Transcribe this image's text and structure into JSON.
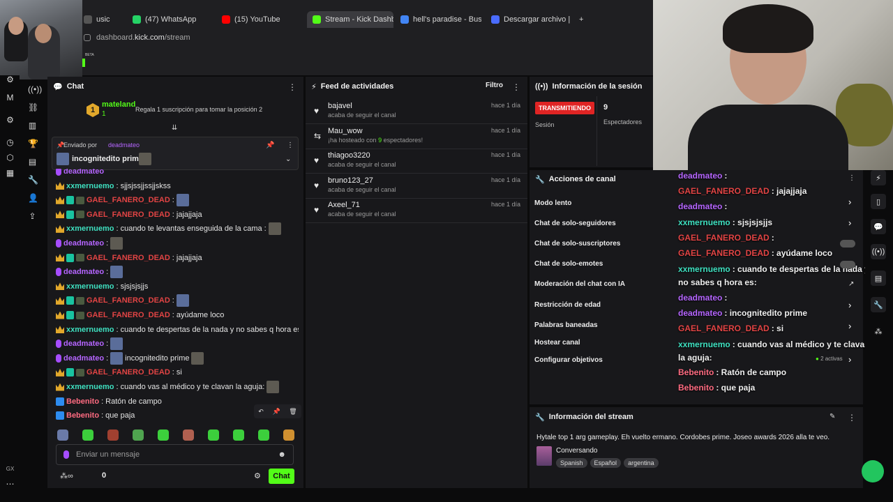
{
  "browser": {
    "tabs": [
      {
        "label": "usic",
        "fav": "#555555"
      },
      {
        "label": "(47) WhatsApp",
        "fav": "#25d366"
      },
      {
        "label": "(15) YouTube",
        "fav": "#ff0000"
      },
      {
        "label": "Stream - Kick Dashboard",
        "fav": "#53fc18",
        "active": true
      },
      {
        "label": "hell's paradise - Buscar c",
        "fav": "#4285f4"
      },
      {
        "label": "Descargar archivo | iLove",
        "fav": "#4a6cff"
      }
    ],
    "new_tab": "+",
    "url_host": "dashboard.",
    "url_domain": "kick.com",
    "url_path": "/stream",
    "beta": "BETA"
  },
  "leftnav": {
    "gx_label": "GX"
  },
  "chat": {
    "title": "Chat",
    "leader_name": "mateland",
    "leader_rank": "1",
    "leader_subs": "1",
    "gift_prompt": "Regala 1 suscripción para tomar la posición 2",
    "pinned_prefix": "Enviado por",
    "pinned_user": "deadmateo",
    "pinned_text": "incognitedito prime",
    "messages": [
      {
        "user": "deadmateo",
        "cls": "u-purple",
        "badges": [
          "mic"
        ],
        "text": ""
      },
      {
        "user": "xxmernuemo",
        "cls": "u-teal",
        "badges": [
          "crown"
        ],
        "text": ": sjjsjssjjssjjskss"
      },
      {
        "user": "GAEL_FANERO_DEAD",
        "cls": "u-red",
        "badges": [
          "crown",
          "sub",
          "lp"
        ],
        "text": ":",
        "emote": true
      },
      {
        "user": "GAEL_FANERO_DEAD",
        "cls": "u-red",
        "badges": [
          "crown",
          "sub",
          "lp"
        ],
        "text": ": jajajjaja"
      },
      {
        "user": "xxmernuemo",
        "cls": "u-teal",
        "badges": [
          "crown"
        ],
        "text": ": cuando te levantas enseguida de la cama :",
        "emote2": true
      },
      {
        "user": "deadmateo",
        "cls": "u-purple",
        "badges": [
          "mic"
        ],
        "text": ":",
        "emote2": true
      },
      {
        "user": "GAEL_FANERO_DEAD",
        "cls": "u-red",
        "badges": [
          "crown",
          "sub",
          "lp"
        ],
        "text": ": jajajjaja"
      },
      {
        "user": "deadmateo",
        "cls": "u-purple",
        "badges": [
          "mic"
        ],
        "text": ":",
        "emote": true
      },
      {
        "user": "xxmernuemo",
        "cls": "u-teal",
        "badges": [
          "crown"
        ],
        "text": ": sjsjsjsjjs"
      },
      {
        "user": "GAEL_FANERO_DEAD",
        "cls": "u-red",
        "badges": [
          "crown",
          "sub",
          "lp"
        ],
        "text": ":",
        "emote": true
      },
      {
        "user": "GAEL_FANERO_DEAD",
        "cls": "u-red",
        "badges": [
          "crown",
          "sub",
          "lp"
        ],
        "text": ": ayúdame loco"
      },
      {
        "user": "xxmernuemo",
        "cls": "u-teal",
        "badges": [
          "crown"
        ],
        "text": ": cuando te despertas de la nada y no sabes q hora es:",
        "emote2": true
      },
      {
        "user": "deadmateo",
        "cls": "u-purple",
        "badges": [
          "mic"
        ],
        "text": ":",
        "emote": true
      },
      {
        "user": "deadmateo",
        "cls": "u-purple",
        "badges": [
          "mic"
        ],
        "text": ":",
        "emote": true,
        "after": "incognitedito prime"
      },
      {
        "user": "GAEL_FANERO_DEAD",
        "cls": "u-red",
        "badges": [
          "crown",
          "sub",
          "lp"
        ],
        "text": ": si"
      },
      {
        "user": "xxmernuemo",
        "cls": "u-teal",
        "badges": [
          "crown"
        ],
        "text": ": cuando vas al médico y te clavan la aguja:",
        "emote2": true
      },
      {
        "user": "Bebenito",
        "cls": "u-pink",
        "badges": [
          "boost"
        ],
        "text": ": Ratón de campo"
      },
      {
        "user": "Bebenito",
        "cls": "u-pink",
        "badges": [
          "boost"
        ],
        "text": ": que paja"
      }
    ],
    "input_placeholder": "Enviar un mensaje",
    "count": "0",
    "send_label": "Chat"
  },
  "feed": {
    "title": "Feed de actividades",
    "filter_label": "Filtro",
    "items": [
      {
        "icon": "heart",
        "name": "bajavel",
        "desc": "acaba de seguir el canal",
        "time": "hace 1 día"
      },
      {
        "icon": "host",
        "name": "Mau_wow",
        "desc_pre": "¡ha hosteado con ",
        "desc_num": "9",
        "desc_post": " espectadores!",
        "time": "hace 1 día"
      },
      {
        "icon": "heart",
        "name": "thiagoo3220",
        "desc": "acaba de seguir el canal",
        "time": "hace 1 día"
      },
      {
        "icon": "heart",
        "name": "bruno123_27",
        "desc": "acaba de seguir el canal",
        "time": "hace 1 día"
      },
      {
        "icon": "heart",
        "name": "Axeel_71",
        "desc": "acaba de seguir el canal",
        "time": "hace 1 día"
      }
    ]
  },
  "session": {
    "title": "Información de la sesión",
    "live_label": "TRANSMITIENDO",
    "session_label": "Sesión",
    "viewers_value": "9",
    "viewers_label": "Espectadores"
  },
  "actions": {
    "title": "Acciones de canal",
    "items": [
      "Modo lento",
      "Chat de solo-seguidores",
      "Chat de solo-suscriptores",
      "Chat de solo-emotes",
      "Moderación del chat con IA",
      "Restricción de edad",
      "Palabras baneadas",
      "Hostear canal",
      "Configurar objetivos"
    ],
    "active_goals": "2 activas"
  },
  "overlay": {
    "lines": [
      {
        "user": "deadmateo",
        "cls": "u-purple",
        "text": " :"
      },
      {
        "user": "GAEL_FANERO_DEAD",
        "cls": "u-red",
        "text": " : jajajjaja"
      },
      {
        "user": "deadmateo",
        "cls": "u-purple",
        "text": " :"
      },
      {
        "user": "xxmernuemo",
        "cls": "u-teal",
        "text": " : sjsjsjsjjs"
      },
      {
        "user": "GAEL_FANERO_DEAD",
        "cls": "u-red",
        "text": " :"
      },
      {
        "user": "GAEL_FANERO_DEAD",
        "cls": "u-red",
        "text": " : ayúdame loco"
      },
      {
        "user": "xxmernuemo",
        "cls": "u-teal",
        "text": " : cuando te despertas de la nada y"
      },
      {
        "user": "",
        "cls": "",
        "text": "no sabes q hora es:"
      },
      {
        "user": "deadmateo",
        "cls": "u-purple",
        "text": " :"
      },
      {
        "user": "deadmateo",
        "cls": "u-purple",
        "text": " : incognitedito prime"
      },
      {
        "user": "GAEL_FANERO_DEAD",
        "cls": "u-red",
        "text": " : si"
      },
      {
        "user": "xxmernuemo",
        "cls": "u-teal",
        "text": " : cuando vas al médico y te clavan"
      },
      {
        "user": "",
        "cls": "",
        "text": "la aguja:"
      },
      {
        "user": "Bebenito",
        "cls": "u-pink",
        "text": " : Ratón de campo"
      },
      {
        "user": "Bebenito",
        "cls": "u-pink",
        "text": " : que paja"
      }
    ]
  },
  "streaminfo": {
    "title": "Información del stream",
    "stream_title": "Hytale top 1 arg gameplay. Eh vuelto ermano. Cordobes prime. Joseo awards 2026 alla te veo.",
    "category": "Conversando",
    "tags": [
      "Spanish",
      "Español",
      "argentina"
    ]
  }
}
